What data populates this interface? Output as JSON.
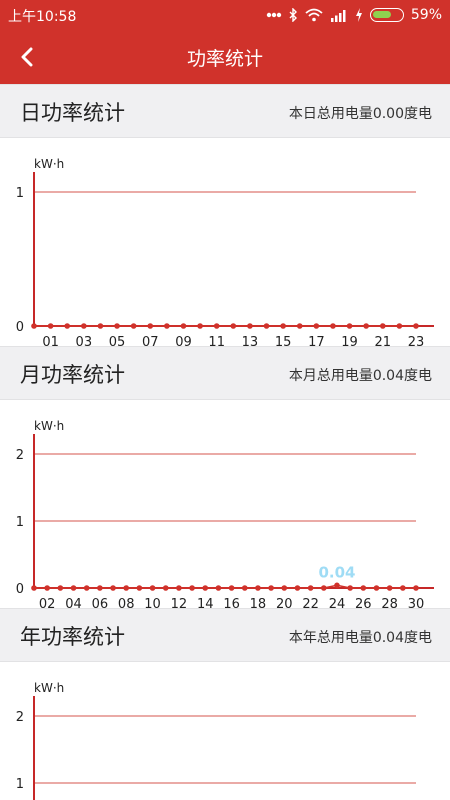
{
  "status_bar": {
    "time": "上午10:58",
    "battery_percent": "59%",
    "icons": [
      "dots-icon",
      "bluetooth-icon",
      "wifi-icon",
      "signal-icon",
      "charging-icon",
      "battery-icon"
    ]
  },
  "app_bar": {
    "title": "功率统计",
    "back_icon": "back-arrow-icon"
  },
  "colors": {
    "primary": "#d0322b",
    "axis": "#c62828",
    "grid": "#d5554d",
    "point": "#d0322b",
    "data_label": "#9fdcf5",
    "header_bg": "#f0f0f2",
    "battery": "#8fd14f"
  },
  "sections": {
    "day": {
      "title": "日功率统计",
      "total": "本日总用电量0.00度电"
    },
    "month": {
      "title": "月功率统计",
      "total": "本月总用电量0.04度电"
    },
    "year": {
      "title": "年功率统计",
      "total": "本年总用电量0.04度电"
    }
  },
  "chart_data": [
    {
      "type": "line",
      "unit": "kW·h",
      "ylim": [
        0,
        1
      ],
      "y_ticks": [
        "0",
        "1"
      ],
      "x_tick_labels": [
        "01",
        "03",
        "05",
        "07",
        "09",
        "11",
        "13",
        "15",
        "17",
        "19",
        "21",
        "23"
      ],
      "x": [
        0,
        1,
        2,
        3,
        4,
        5,
        6,
        7,
        8,
        9,
        10,
        11,
        12,
        13,
        14,
        15,
        16,
        17,
        18,
        19,
        20,
        21,
        22,
        23
      ],
      "values": [
        0,
        0,
        0,
        0,
        0,
        0,
        0,
        0,
        0,
        0,
        0,
        0,
        0,
        0,
        0,
        0,
        0,
        0,
        0,
        0,
        0,
        0,
        0,
        0
      ],
      "grid": true
    },
    {
      "type": "line",
      "unit": "kW·h",
      "ylim": [
        0,
        2
      ],
      "y_ticks": [
        "0",
        "1",
        "2"
      ],
      "x_tick_labels": [
        "02",
        "04",
        "06",
        "08",
        "10",
        "12",
        "14",
        "16",
        "18",
        "20",
        "22",
        "24",
        "26",
        "28",
        "30"
      ],
      "x": [
        1,
        2,
        3,
        4,
        5,
        6,
        7,
        8,
        9,
        10,
        11,
        12,
        13,
        14,
        15,
        16,
        17,
        18,
        19,
        20,
        21,
        22,
        23,
        24,
        25,
        26,
        27,
        28,
        29,
        30
      ],
      "values": [
        0,
        0,
        0,
        0,
        0,
        0,
        0,
        0,
        0,
        0,
        0,
        0,
        0,
        0,
        0,
        0,
        0,
        0,
        0,
        0,
        0,
        0,
        0,
        0.04,
        0,
        0,
        0,
        0,
        0,
        0
      ],
      "data_labels": [
        {
          "x": 24,
          "text": "0.04"
        }
      ],
      "grid": true
    },
    {
      "type": "line",
      "unit": "kW·h",
      "ylim": [
        0,
        2
      ],
      "y_ticks": [
        "1",
        "2"
      ],
      "x_tick_labels": [],
      "x": [],
      "values": [],
      "grid": true
    }
  ]
}
